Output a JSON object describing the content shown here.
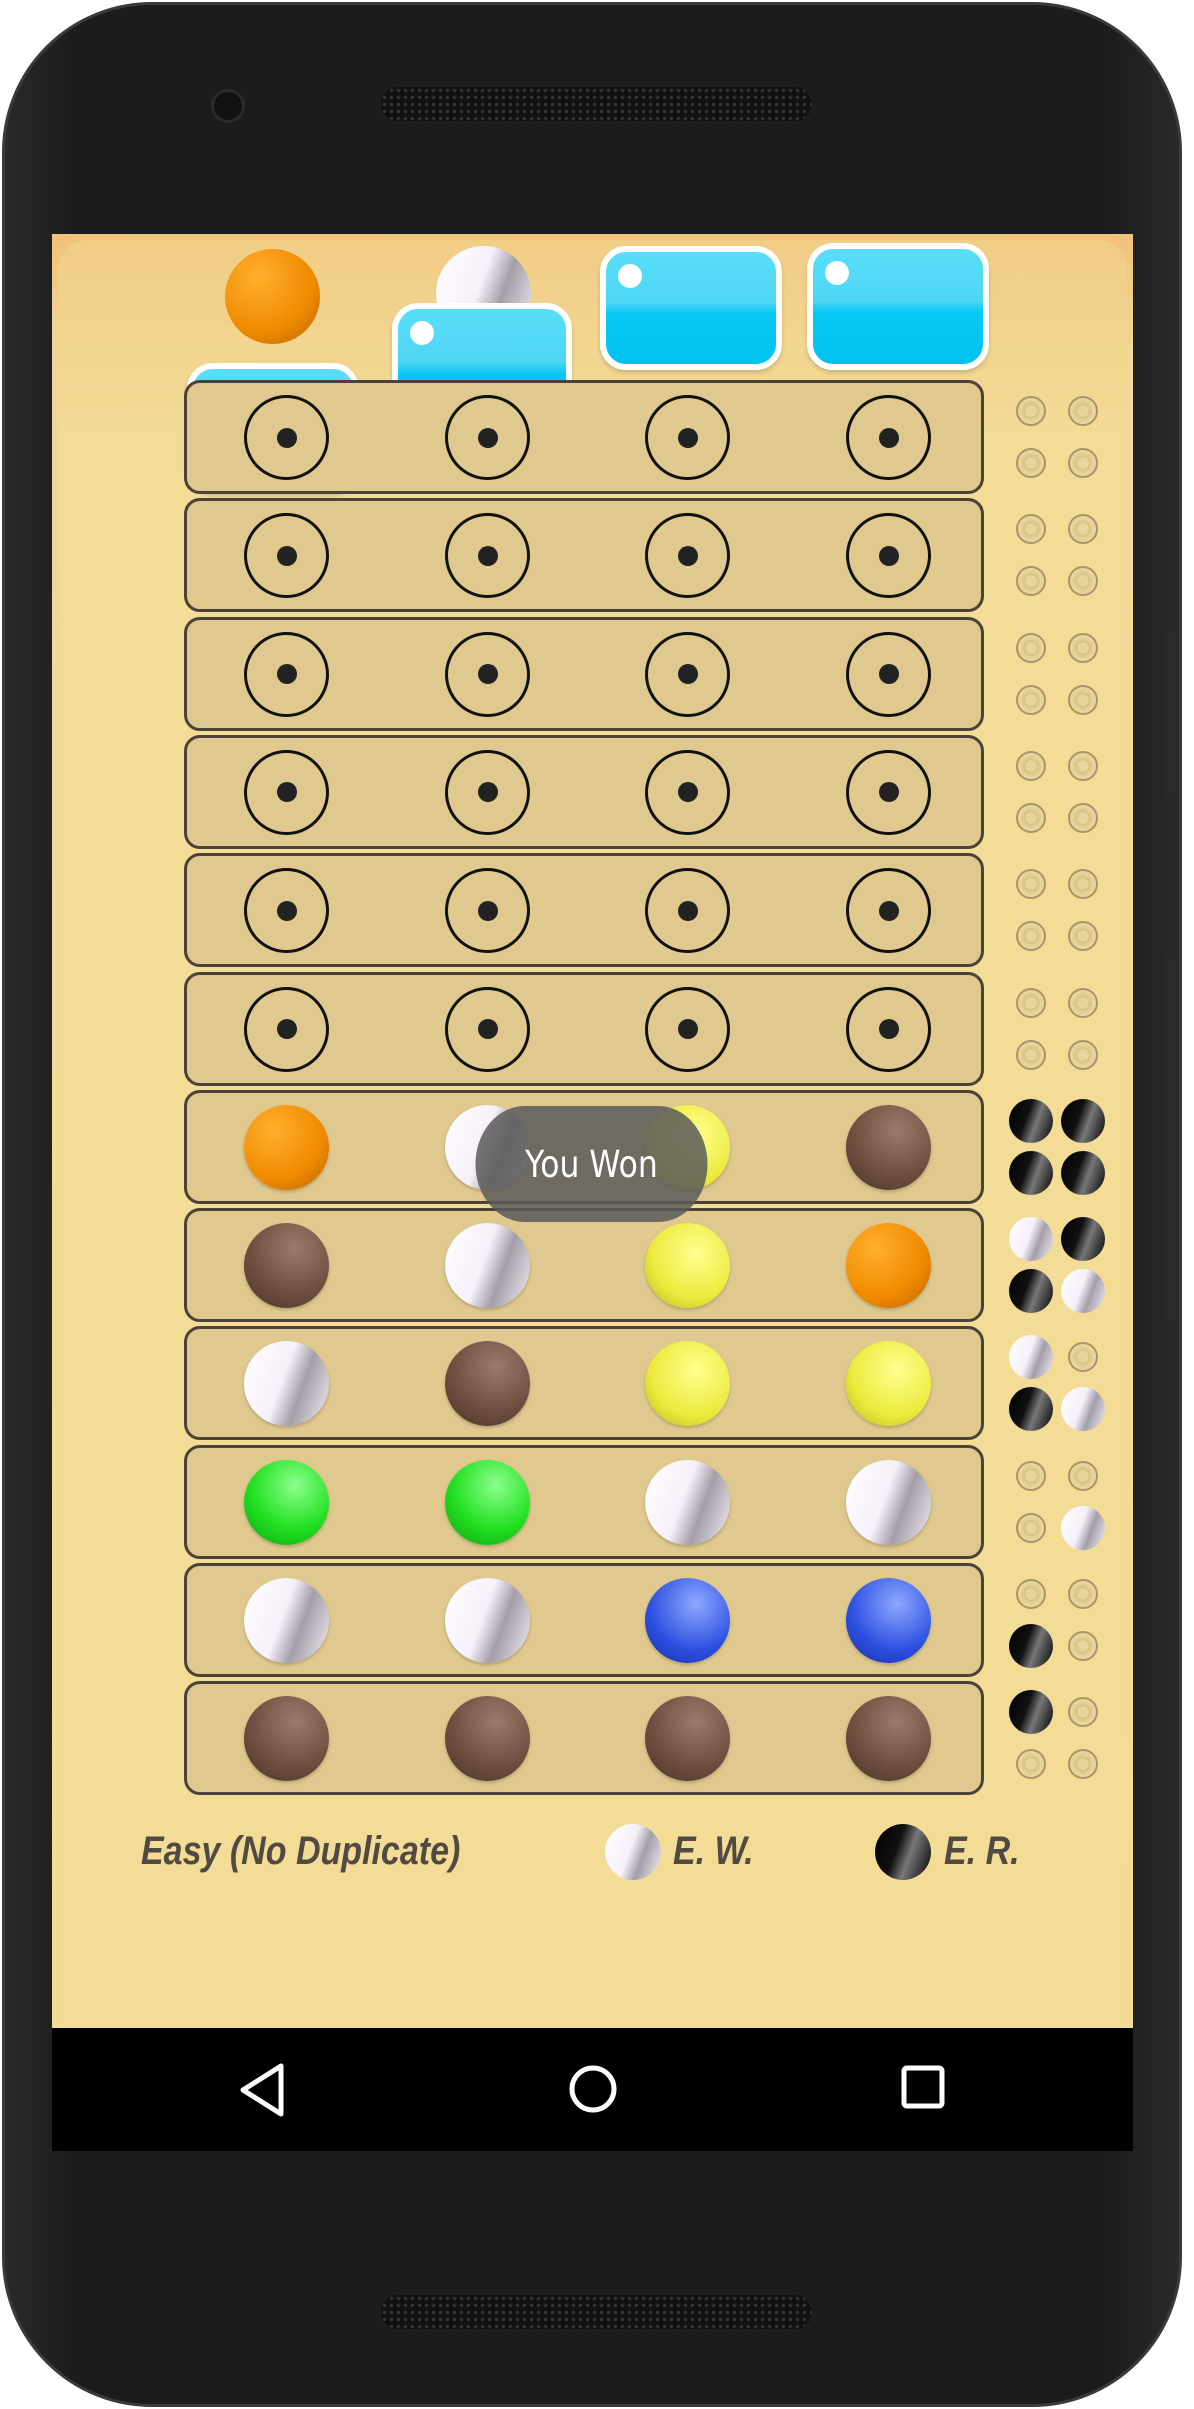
{
  "colors": {
    "orange": "radial-gradient(circle at 35% 30%,#ffb02e,#f08a00 60%,#b86400)",
    "white": "linear-gradient(110deg,#fff 0,#f6f0fa 45%,#a49ea8 65%,#f3eef6 100%)",
    "yellow": "radial-gradient(circle at 60% 35%,#ffff90,#ecea3c 60%,#b8b420)",
    "brown": "radial-gradient(circle at 60% 30%,#9a7c6c,#6b4d3e 60%,#4a3226)",
    "green": "radial-gradient(circle at 60% 30%,#8cff8c,#22e022 55%,#10a010)",
    "blue": "radial-gradient(circle at 60% 30%,#8ea8ff,#2b4fe0 60%,#1a2fa0)",
    "black": "linear-gradient(110deg,#000 0,#111 40%,#777 60%,#000 100%)",
    "accent": "#02c2ef"
  },
  "secret": {
    "visible": [
      "orange",
      "white"
    ]
  },
  "rows": [
    {
      "pegs": [
        null,
        null,
        null,
        null
      ],
      "feedback": [
        "empty",
        "empty",
        "empty",
        "empty"
      ]
    },
    {
      "pegs": [
        null,
        null,
        null,
        null
      ],
      "feedback": [
        "empty",
        "empty",
        "empty",
        "empty"
      ]
    },
    {
      "pegs": [
        null,
        null,
        null,
        null
      ],
      "feedback": [
        "empty",
        "empty",
        "empty",
        "empty"
      ]
    },
    {
      "pegs": [
        null,
        null,
        null,
        null
      ],
      "feedback": [
        "empty",
        "empty",
        "empty",
        "empty"
      ]
    },
    {
      "pegs": [
        null,
        null,
        null,
        null
      ],
      "feedback": [
        "empty",
        "empty",
        "empty",
        "empty"
      ]
    },
    {
      "pegs": [
        null,
        null,
        null,
        null
      ],
      "feedback": [
        "empty",
        "empty",
        "empty",
        "empty"
      ]
    },
    {
      "pegs": [
        "orange",
        "white",
        "yellow",
        "brown"
      ],
      "feedback": [
        "black",
        "black",
        "black",
        "black"
      ]
    },
    {
      "pegs": [
        "brown",
        "white",
        "yellow",
        "orange"
      ],
      "feedback": [
        "white",
        "black",
        "black",
        "white"
      ]
    },
    {
      "pegs": [
        "white",
        "brown",
        "yellow",
        "yellow"
      ],
      "feedback": [
        "white",
        "empty",
        "black",
        "white"
      ]
    },
    {
      "pegs": [
        "green",
        "green",
        "white",
        "white"
      ],
      "feedback": [
        "empty",
        "empty",
        "empty",
        "white"
      ]
    },
    {
      "pegs": [
        "white",
        "white",
        "blue",
        "blue"
      ],
      "feedback": [
        "empty",
        "empty",
        "black",
        "empty"
      ]
    },
    {
      "pegs": [
        "brown",
        "brown",
        "brown",
        "brown"
      ],
      "feedback": [
        "black",
        "empty",
        "empty",
        "empty"
      ]
    }
  ],
  "toast": "You Won",
  "legend": {
    "mode": "Easy (No Duplicate)",
    "white_label": "E. W.",
    "black_label": "E. R."
  },
  "navbar": {
    "back": "back-icon",
    "home": "home-icon",
    "recents": "recents-icon"
  }
}
